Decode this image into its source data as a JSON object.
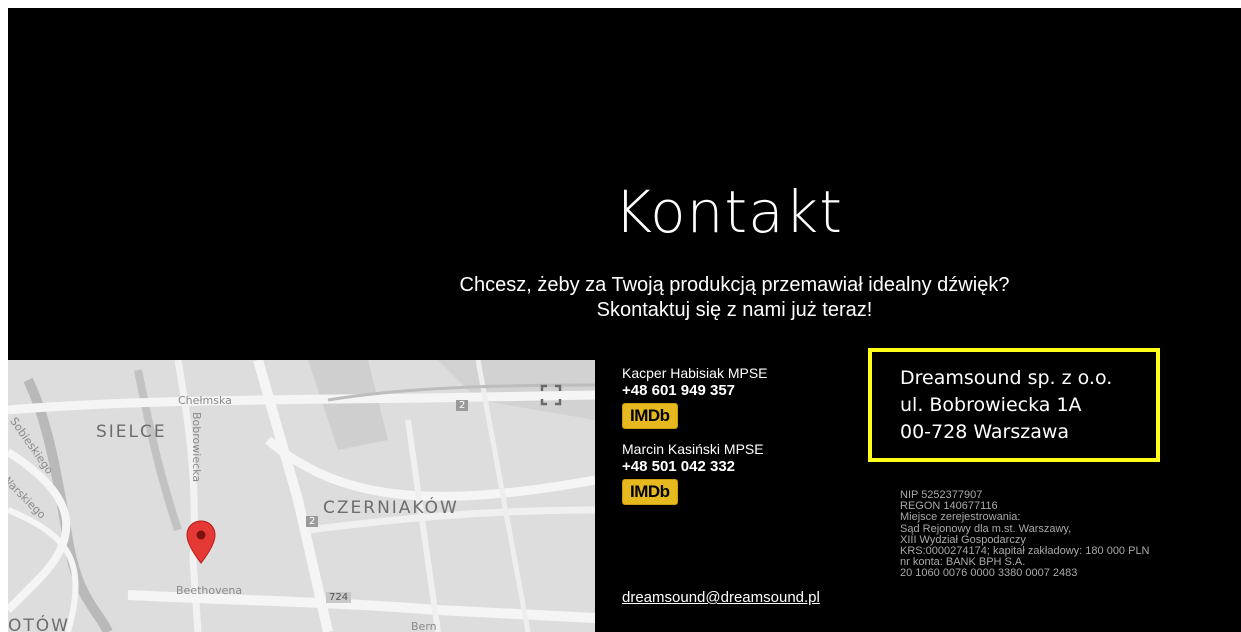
{
  "hero": {
    "title": "Kontakt",
    "subtitle_line1": "Chcesz, żeby za Twoją produkcją przemawiał idealny dźwięk?",
    "subtitle_line2": "Skontaktuj się z nami już teraz!"
  },
  "map": {
    "districts": [
      "SIELCE",
      "CZERNIAKÓW"
    ],
    "streets": [
      "Chełmska",
      "Bobrowiecka",
      "Sobieskiego",
      "Beethovena",
      "Warskiego",
      "Bern"
    ],
    "partial_labels": [
      "OTÓW"
    ],
    "road_badges": [
      "2",
      "2",
      "724"
    ],
    "icons": {
      "fullscreen": "fullscreen-icon",
      "pin": "map-pin-icon"
    }
  },
  "contacts": [
    {
      "name": "Kacper Habisiak MPSE",
      "phone": "+48 601 949 357",
      "imdb_label": "IMDb"
    },
    {
      "name": "Marcin Kasiński MPSE",
      "phone": "+48 501 042 332",
      "imdb_label": "IMDb"
    }
  ],
  "email": "dreamsound@dreamsound.pl",
  "company": {
    "name": "Dreamsound sp. z o.o.",
    "street": "ul. Bobrowiecka 1A",
    "city": "00-728 Warszawa"
  },
  "legal": [
    "NIP 5252377907",
    "REGON 140677116",
    "Miejsce zerejestrowania:",
    "Sąd Rejonowy dla m.st. Warszawy,",
    "XIII Wydział Gospodarczy",
    "KRS:0000274174; kapitał zakładowy: 180 000 PLN",
    "nr konta: BANK BPH S.A.",
    "20 1060 0076 0000 3380 0007 2483"
  ],
  "colors": {
    "background": "#000000",
    "highlight_border": "#ffff1a",
    "imdb_yellow": "#e6b91e",
    "map_pin": "#e53935"
  }
}
